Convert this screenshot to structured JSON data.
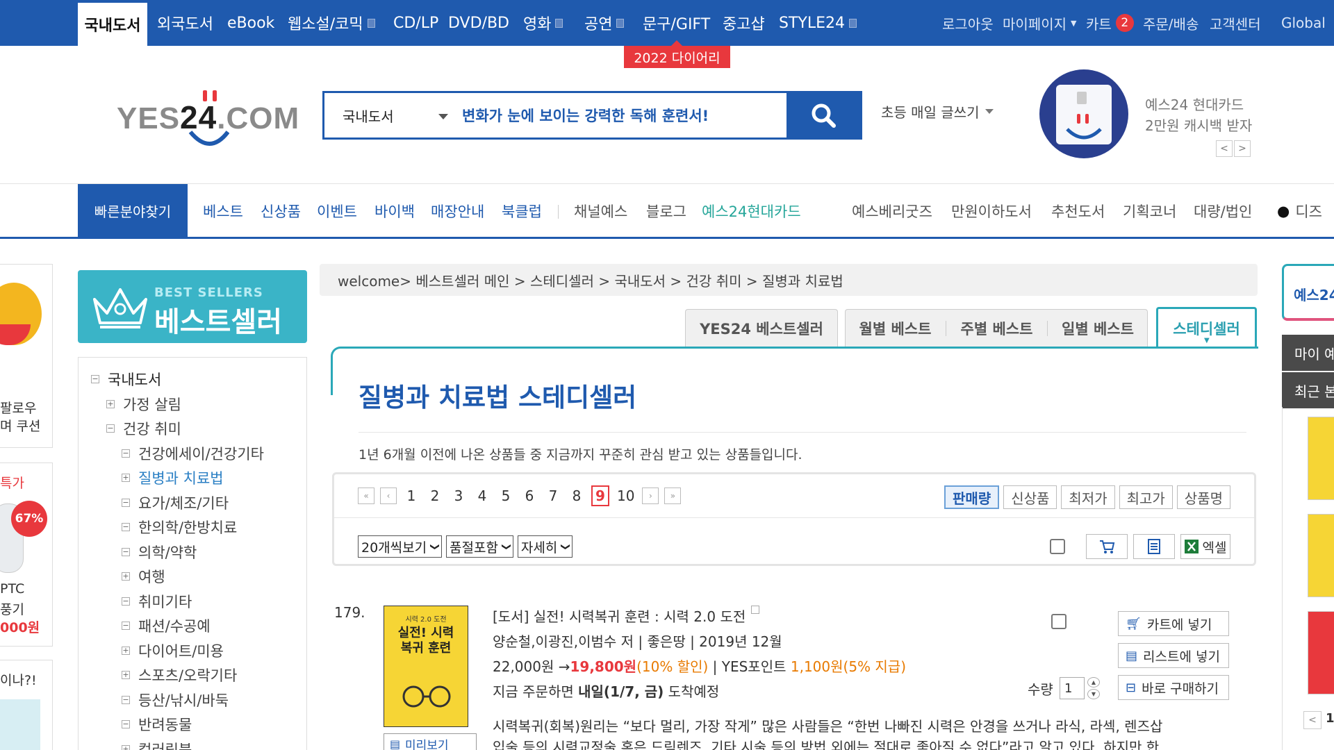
{
  "topnav": {
    "categories": [
      "국내도서",
      "외국도서",
      "eBook",
      "웹소설/코믹",
      "CD/LP",
      "DVD/BD",
      "영화",
      "공연",
      "문구/GIFT",
      "중고샵",
      "STYLE24"
    ],
    "util": [
      "로그아웃",
      "마이페이지",
      "카트",
      "주문/배송",
      "고객센터",
      "Global"
    ],
    "cart_count": "2",
    "promo_badge": "2022 다이어리"
  },
  "header": {
    "logo": {
      "left": "YES",
      "num": "24",
      "right": ".COM"
    },
    "search": {
      "category": "국내도서",
      "value": "변화가 눈에 보이는 강력한 독해 훈련서!"
    },
    "keyword": "초등 매일 글쓰기",
    "card_ad": {
      "line1": "예스24 현대카드",
      "line2": "2만원 캐시백 받자",
      "prev": "<",
      "next": ">"
    }
  },
  "secnav": {
    "quick": "빠른분야찾기",
    "items_blue": [
      "베스트",
      "신상품",
      "이벤트",
      "바이백",
      "매장안내",
      "북클럽"
    ],
    "items_gray": [
      "채널예스",
      "블로그"
    ],
    "item_green": "예스24현대카드",
    "items_right": [
      "예스베리굿즈",
      "만원이하도서",
      "추천도서",
      "기획코너",
      "대량/법인",
      "디즈"
    ]
  },
  "leftstrip": {
    "box1": [
      "팔로우",
      "며 쿠션"
    ],
    "box2_top": "특가",
    "box2_badge": "67%",
    "box2_bottom": [
      "PTC",
      "풍기",
      "000원"
    ],
    "box3": "이나?!"
  },
  "sidebar": {
    "banner_en": "BEST SELLERS",
    "banner_ko": "베스트셀러",
    "tree": [
      {
        "label": "국내도서",
        "sign": "−",
        "level": 0
      },
      {
        "label": "가정 살림",
        "sign": "+",
        "level": 1
      },
      {
        "label": "건강 취미",
        "sign": "−",
        "level": 1
      },
      {
        "label": "건강에세이/건강기타",
        "sign": "−",
        "level": 2
      },
      {
        "label": "질병과 치료법",
        "sign": "+",
        "level": 2,
        "selected": true
      },
      {
        "label": "요가/체조/기타",
        "sign": "−",
        "level": 2
      },
      {
        "label": "한의학/한방치료",
        "sign": "−",
        "level": 2
      },
      {
        "label": "의학/약학",
        "sign": "−",
        "level": 2
      },
      {
        "label": "여행",
        "sign": "+",
        "level": 2
      },
      {
        "label": "취미기타",
        "sign": "−",
        "level": 2
      },
      {
        "label": "패션/수공예",
        "sign": "−",
        "level": 2
      },
      {
        "label": "다이어트/미용",
        "sign": "+",
        "level": 2
      },
      {
        "label": "스포츠/오락기타",
        "sign": "+",
        "level": 2
      },
      {
        "label": "등산/낚시/바둑",
        "sign": "−",
        "level": 2
      },
      {
        "label": "반려동물",
        "sign": "−",
        "level": 2
      },
      {
        "label": "컬러링북",
        "sign": "+",
        "level": 2
      }
    ]
  },
  "main": {
    "breadcrumb": "welcome> 베스트셀러 메인 > 스테디셀러 > 국내도서 > 건강 취미 > 질병과 치료법",
    "tabs": [
      "YES24 베스트셀러",
      "월별 베스트",
      "주별 베스트",
      "일별 베스트",
      "스테디셀러"
    ],
    "title": "질병과 치료법 스테디셀러",
    "description": "1년 6개월 이전에 나온 상품들 중 지금까지 꾸준히 관심 받고 있는 상품들입니다.",
    "pager": {
      "first": "«",
      "prev": "‹",
      "pages": [
        "1",
        "2",
        "3",
        "4",
        "5",
        "6",
        "7",
        "8",
        "9",
        "10"
      ],
      "current": "9",
      "next": "›",
      "last": "»"
    },
    "sorts": [
      "판매량",
      "신상품",
      "최저가",
      "최고가",
      "상품명"
    ],
    "selects": [
      "20개씩보기",
      "품절포함",
      "자세히"
    ],
    "excel_label": "엑셀"
  },
  "product": {
    "rank": "179.",
    "cover_top": "시력 2.0 도전",
    "cover_title": "실전! 시력복귀 훈련",
    "preview_label": "미리보기",
    "title": "[도서] 실전! 시력복귀 훈련 : 시력 2.0 도전",
    "author_line": "양순철,이광진,이범수 저 | 좋은땅 | 2019년 12월",
    "price_list": "22,000원 →",
    "price_sale": "19,800원",
    "discount": "(10% 할인)",
    "points_label": " | YES포인트 ",
    "points": "1,100원",
    "points_rate": "(5% 지급)",
    "delivery_prefix": "지금 주문하면 ",
    "delivery_date": "내일(1/7, 금)",
    "delivery_suffix": " 도착예정",
    "summary1": "시력복귀(회복)원리는 “보다 멀리, 가장 작게” 많은 사람들은 “한번 나빠진 시력은 안경을 쓰거나 라식, 라섹, 렌즈삽",
    "summary2": "입술 등의 시력교정술 혹은 드림렌즈, 기타 시술 등의 방법 외에는 절대로 좋아질 수 없다”라고 알고 있다. 하지만 한",
    "buttons": [
      "카트에 넣기",
      "리스트에 넣기",
      "바로 구매하기"
    ],
    "qty_label": "수량",
    "qty": "1"
  },
  "rightstrip": {
    "top": "예스24",
    "dark1": "마이 예",
    "dark2": "최근 본",
    "page_prev": "<",
    "page_num": "1"
  },
  "colors": {
    "brand_blue": "#1f5aae",
    "teal": "#2aa8b8",
    "red": "#e8383d",
    "green": "#26a69a"
  }
}
